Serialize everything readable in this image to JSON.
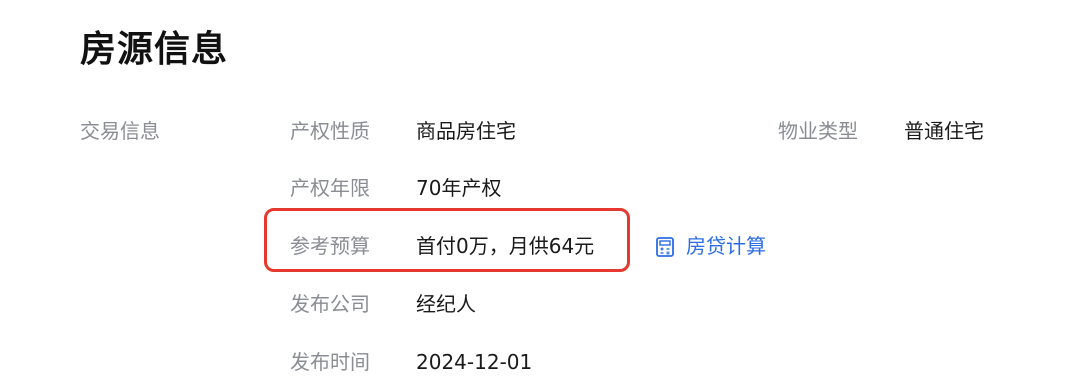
{
  "page": {
    "title": "房源信息"
  },
  "section": {
    "label": "交易信息"
  },
  "fields": [
    {
      "label": "产权性质",
      "value": "商品房住宅"
    },
    {
      "label": "产权年限",
      "value": "70年产权"
    },
    {
      "label": "参考预算",
      "value": "首付0万，月供64元"
    },
    {
      "label": "发布公司",
      "value": "经纪人"
    },
    {
      "label": "发布时间",
      "value": "2024-12-01"
    }
  ],
  "property_type": {
    "label": "物业类型",
    "value": "普通住宅"
  },
  "mortgage_link": {
    "label": "房贷计算",
    "icon": "calculator-icon",
    "color": "#2b6de4"
  },
  "highlight": {
    "color": "#e5392f"
  }
}
